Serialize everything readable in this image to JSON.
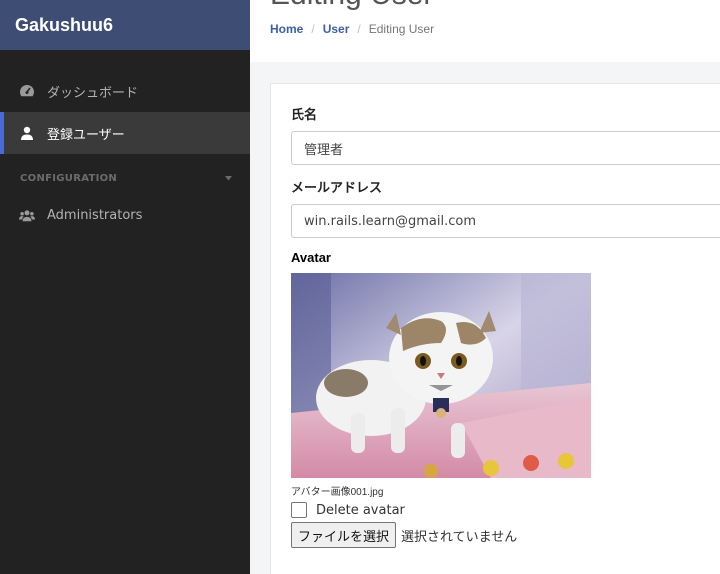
{
  "brand": {
    "name": "Gakushuu6"
  },
  "sidebar": {
    "items": [
      {
        "label": "ダッシュボード",
        "icon": "dashboard-icon"
      },
      {
        "label": "登録ユーザー",
        "icon": "user-icon"
      }
    ],
    "section_label": "CONFIGURATION",
    "config_items": [
      {
        "label": "Administrators",
        "icon": "users-icon"
      }
    ]
  },
  "header": {
    "title": "Editing User",
    "breadcrumb": [
      "Home",
      "User",
      "Editing User"
    ]
  },
  "form": {
    "name_label": "氏名",
    "name_value": "管理者",
    "email_label": "メールアドレス",
    "email_value": "win.rails.learn@gmail.com",
    "avatar_label": "Avatar",
    "avatar_filename": "アバター画像001.jpg",
    "delete_avatar_label": "Delete avatar",
    "file_button_label": "ファイルを選択",
    "file_status": "選択されていません"
  },
  "colors": {
    "brand_bg": "#3d4d73",
    "sidebar_bg": "#222222",
    "active_accent": "#4a6bd6",
    "link": "#3d5fa8"
  }
}
